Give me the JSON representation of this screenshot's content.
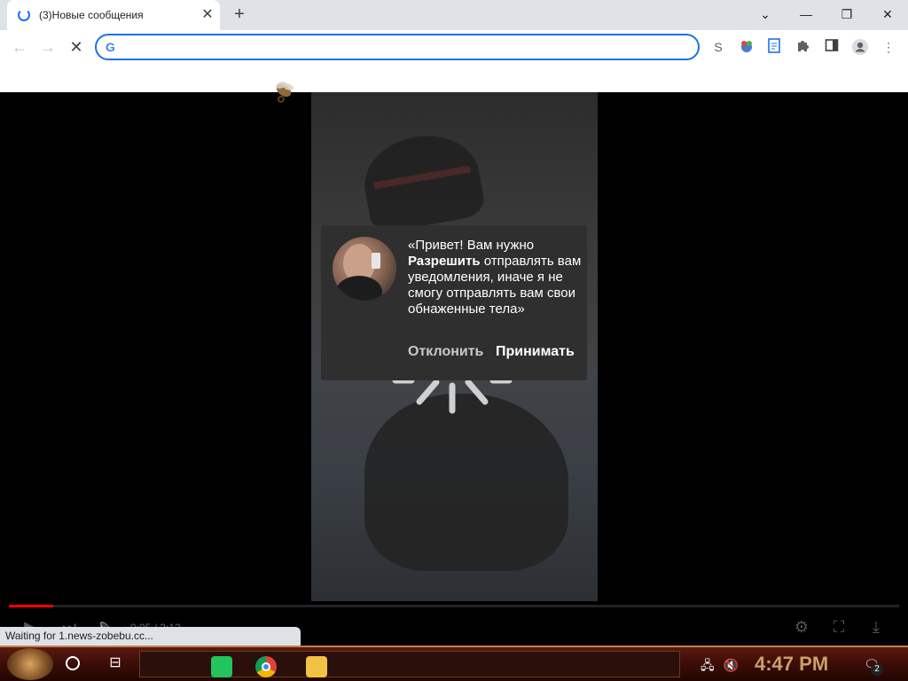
{
  "browser": {
    "tab": {
      "title": "(3)Новые сообщения",
      "close_glyph": "✕"
    },
    "new_tab_glyph": "+",
    "window": {
      "minimize": "—",
      "restore": "❐",
      "close": "✕",
      "tab_search": "⌄"
    },
    "nav": {
      "back": "←",
      "forward": "→",
      "stop": "✕"
    },
    "omnibox": {
      "value": "",
      "placeholder": ""
    },
    "extensions": [
      "s-extension-icon",
      "colorful-extension-icon",
      "notes-extension-icon",
      "puzzle-icon",
      "sidepanel-icon",
      "profile-icon",
      "menu-icon"
    ]
  },
  "popup": {
    "text_before": "«Привет! Вам нужно ",
    "text_bold": "Разрешить",
    "text_after": " отправлять вам уведомления, иначе я не смогу отправлять вам свои обнаженные тела»",
    "decline": "Отклонить",
    "accept": "Принимать"
  },
  "player": {
    "time": "0:05 / 3:12",
    "progress": 0.05
  },
  "status_text": "Waiting for 1.news-zobebu.cc...",
  "taskbar": {
    "clock": "4:47 PM",
    "notification_count": "2"
  },
  "colors": {
    "accent": "#1a73e8",
    "popup_bg": "#2f2f2f",
    "clock": "#c9a067"
  }
}
